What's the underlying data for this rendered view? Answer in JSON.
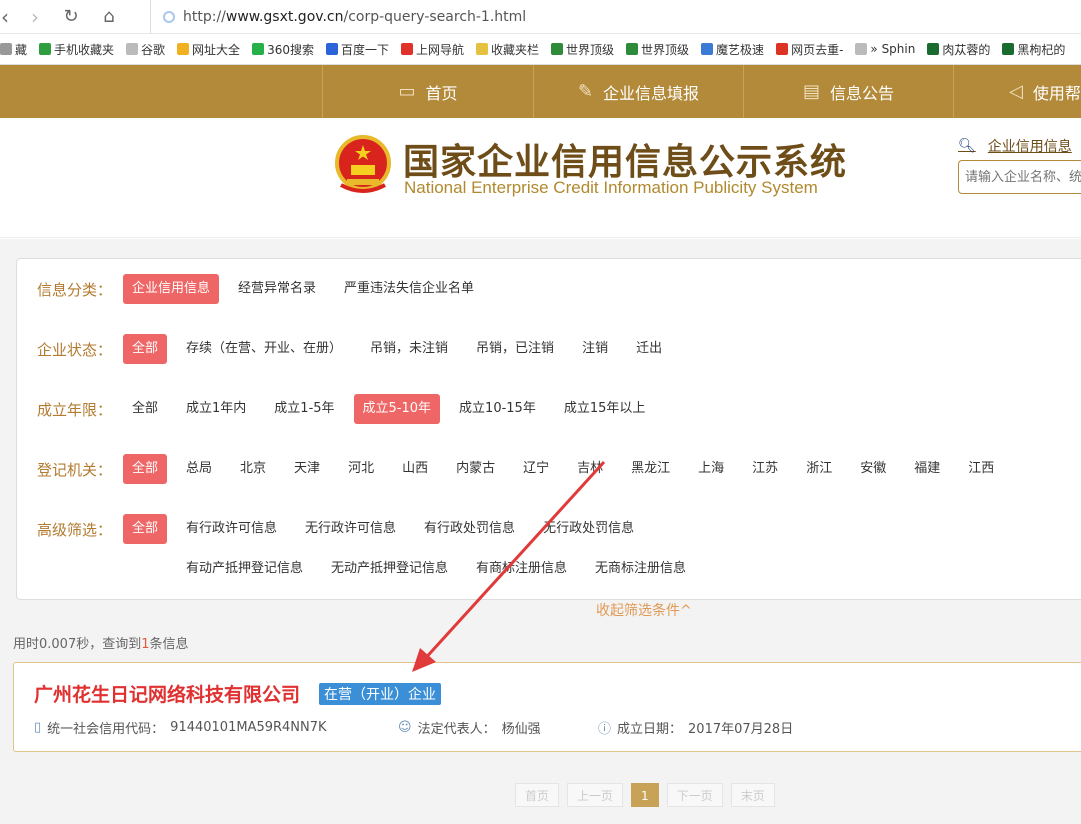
{
  "browser": {
    "url_prefix": "http://",
    "url_domain": "www.gsxt.gov.cn",
    "url_path": "/corp-query-search-1.html",
    "bookmarks": [
      {
        "label": "藏",
        "color": "#999"
      },
      {
        "label": "手机收藏夹",
        "color": "#2e9e3e"
      },
      {
        "label": "谷歌",
        "color": "#bbb"
      },
      {
        "label": "网址大全",
        "color": "#f0b020"
      },
      {
        "label": "360搜索",
        "color": "#25b04a"
      },
      {
        "label": "百度一下",
        "color": "#2d63d8"
      },
      {
        "label": "上网导航",
        "color": "#e0312b"
      },
      {
        "label": "收藏夹栏",
        "color": "#e6c040"
      },
      {
        "label": "世界顶级",
        "color": "#2e8b3a"
      },
      {
        "label": "世界顶级",
        "color": "#2e8b3a"
      },
      {
        "label": "魔艺极速",
        "color": "#3a7bd5"
      },
      {
        "label": "网页去重-",
        "color": "#d32"
      },
      {
        "label": "» Sphin",
        "color": "#bbb"
      },
      {
        "label": "肉苁蓉的",
        "color": "#1a6b2f"
      },
      {
        "label": "黑枸杞的",
        "color": "#1a6b2f"
      }
    ]
  },
  "nav": {
    "items": [
      {
        "label": "首页",
        "icon": "monitor-icon"
      },
      {
        "label": "企业信息填报",
        "icon": "pen-icon"
      },
      {
        "label": "信息公告",
        "icon": "document-icon"
      },
      {
        "label": "使用帮",
        "icon": "speaker-icon"
      }
    ]
  },
  "header": {
    "title_cn": "国家企业信用信息公示系统",
    "title_en": "National Enterprise Credit Information Publicity System",
    "search_link": "企业信用信息",
    "search_placeholder": "请输入企业名称、统"
  },
  "filters": {
    "category": {
      "label": "信息分类：",
      "options": [
        "企业信用信息",
        "经营异常名录",
        "严重违法失信企业名单"
      ]
    },
    "status": {
      "label": "企业状态：",
      "options": [
        "全部",
        "存续（在营、开业、在册）",
        "吊销，未注销",
        "吊销，已注销",
        "注销",
        "迁出"
      ]
    },
    "age": {
      "label": "成立年限：",
      "options": [
        "全部",
        "成立1年内",
        "成立1-5年",
        "成立5-10年",
        "成立10-15年",
        "成立15年以上"
      ]
    },
    "registry": {
      "label": "登记机关：",
      "options": [
        "全部",
        "总局",
        "北京",
        "天津",
        "河北",
        "山西",
        "内蒙古",
        "辽宁",
        "吉林",
        "黑龙江",
        "上海",
        "江苏",
        "浙江",
        "安徽",
        "福建",
        "江西"
      ]
    },
    "advanced": {
      "label": "高级筛选：",
      "row1": [
        "全部",
        "有行政许可信息",
        "无行政许可信息",
        "有行政处罚信息",
        "无行政处罚信息"
      ],
      "row2": [
        "有动产抵押登记信息",
        "无动产抵押登记信息",
        "有商标注册信息",
        "无商标注册信息"
      ]
    },
    "collapse_label": "收起筛选条件^"
  },
  "stats": {
    "prefix": "用时0.007秒，查询到",
    "count": "1",
    "suffix": "条信息"
  },
  "result": {
    "name": "广州花生日记网络科技有限公司",
    "status": "在营（开业）企业",
    "credit_code_label": "统一社会信用代码：",
    "credit_code": "91440101MA59R4NN7K",
    "legal_rep_label": "法定代表人：",
    "legal_rep": "杨仙强",
    "est_date_label": "成立日期：",
    "est_date": "2017年07月28日"
  },
  "pagination": {
    "first": "首页",
    "prev": "上一页",
    "current": "1",
    "next": "下一页",
    "last": "末页"
  },
  "colors": {
    "gold": "#b38a3a",
    "active_tag": "#ef6666",
    "status_blue": "#3b8fd6",
    "corp_red": "#e03030"
  }
}
